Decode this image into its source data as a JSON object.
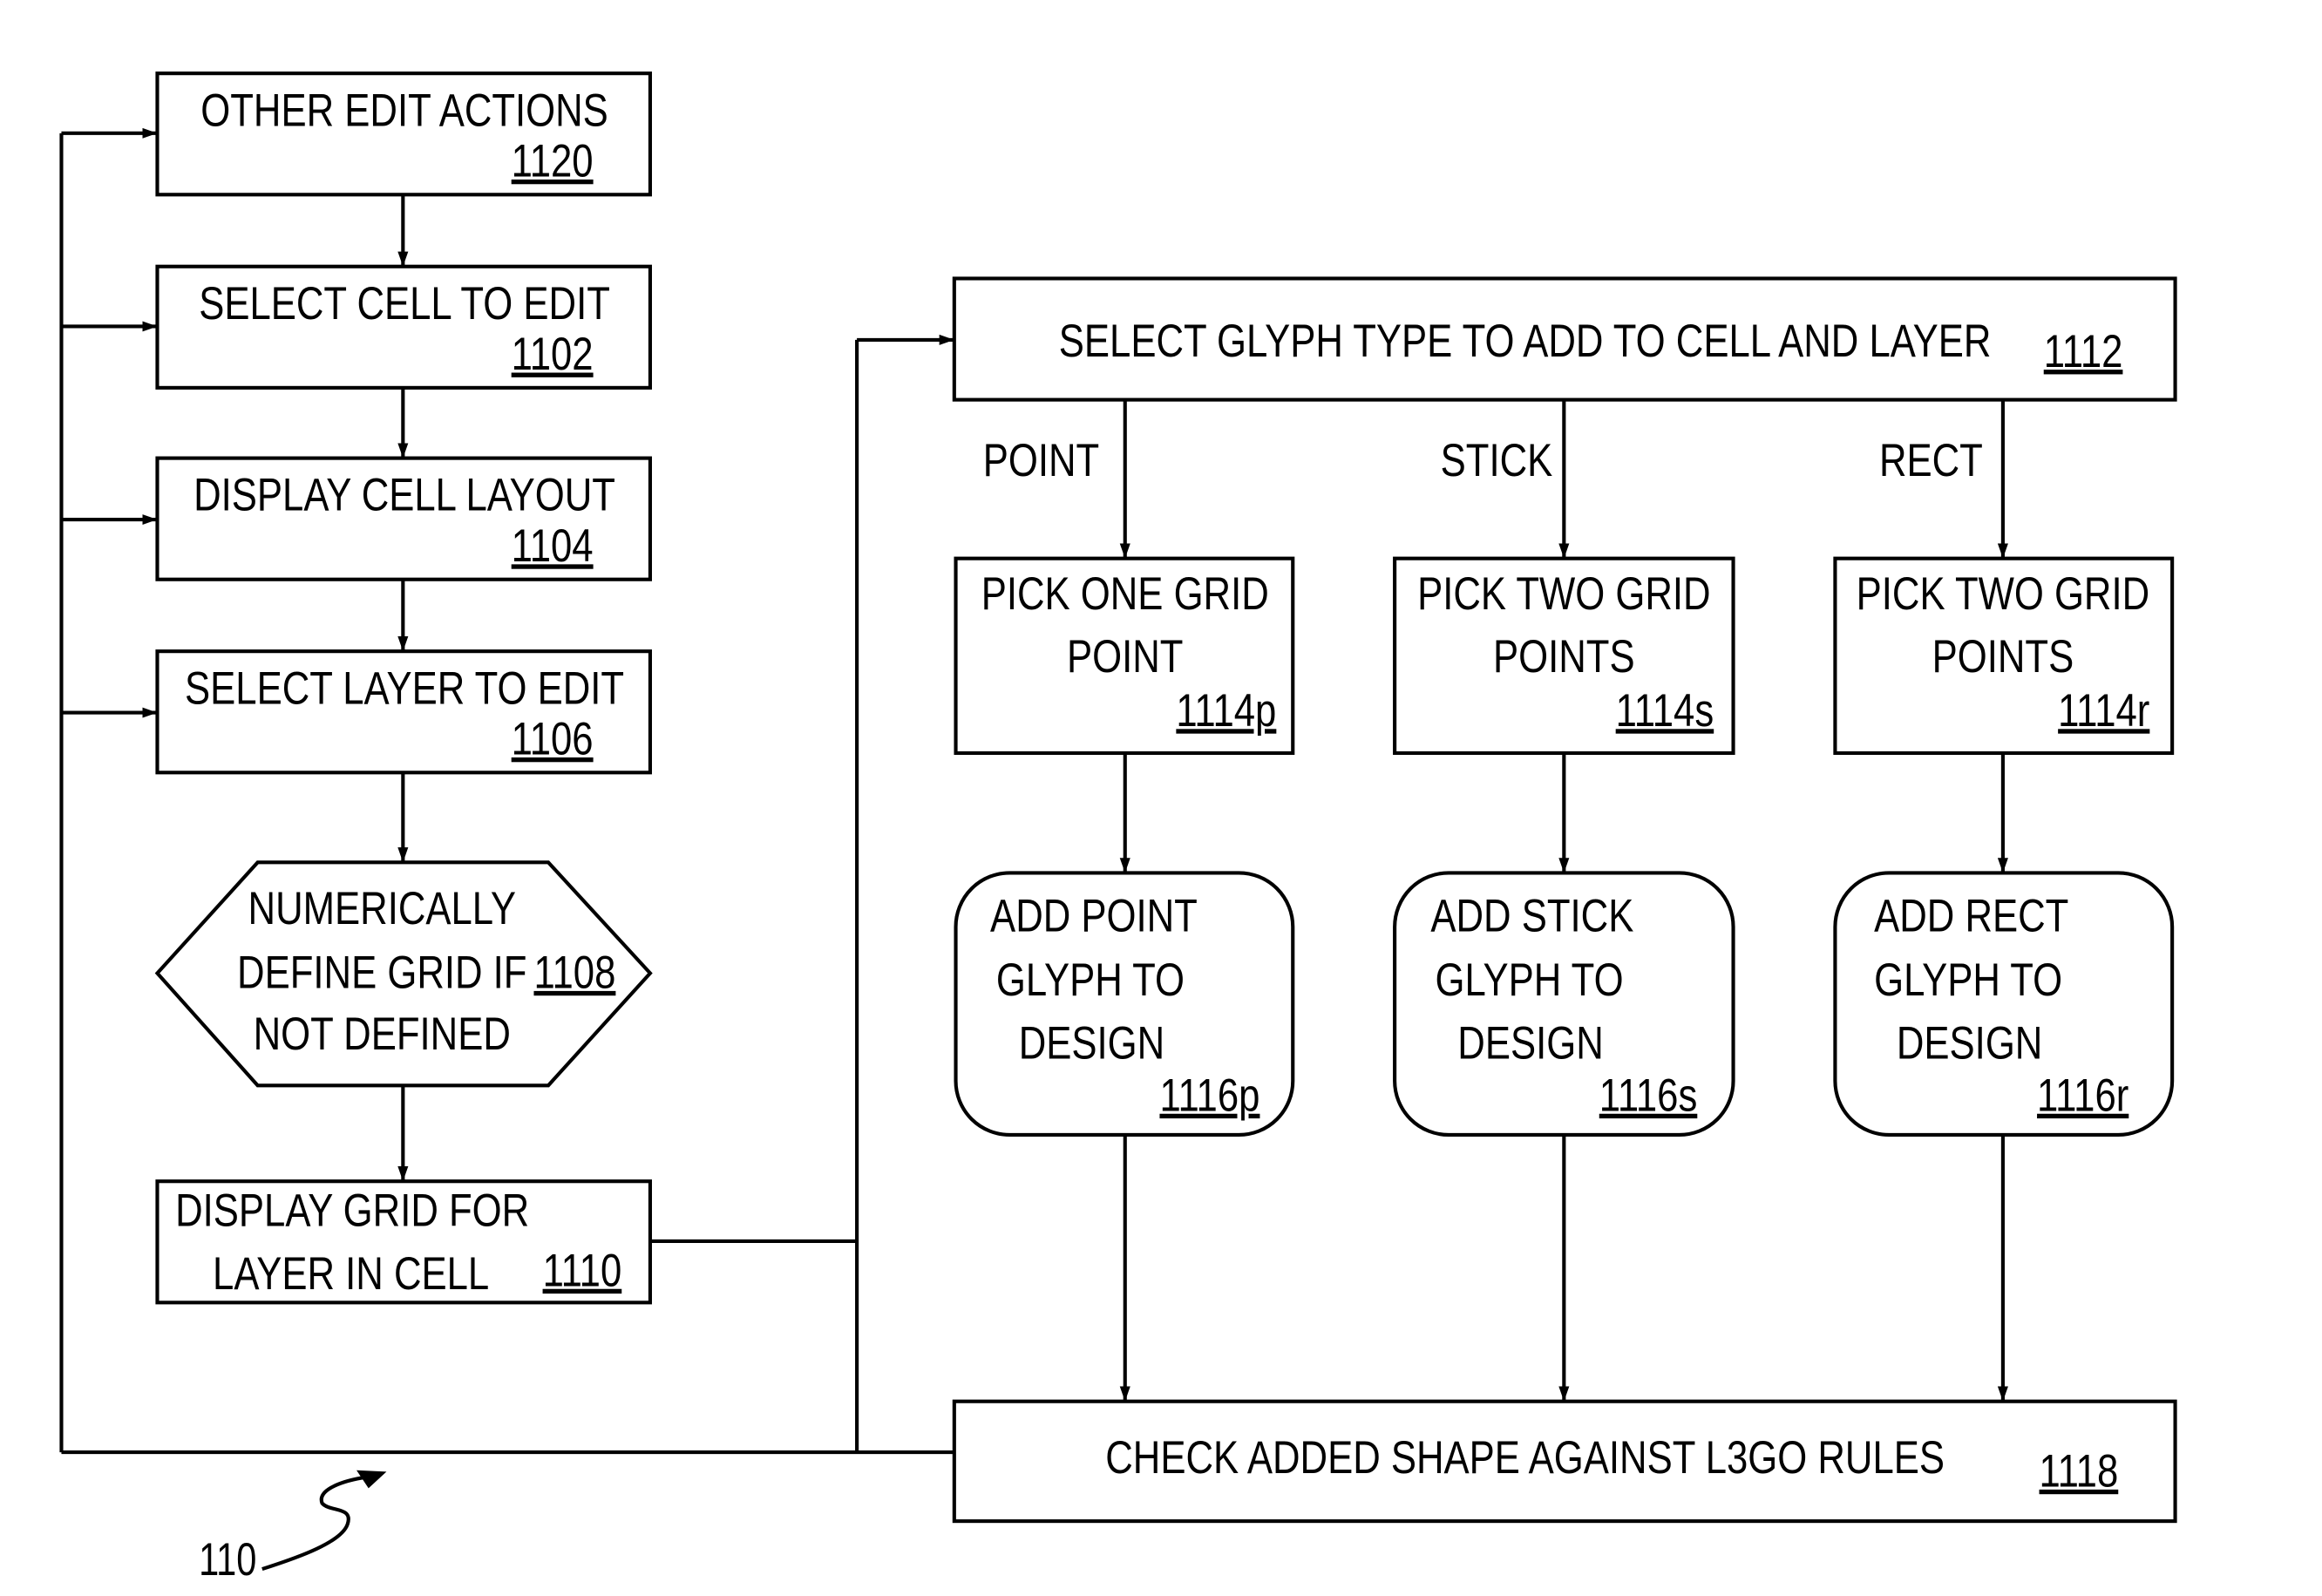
{
  "figure": {
    "reference_label": "110",
    "nodes": {
      "n1120": {
        "lines": [
          "OTHER EDIT ACTIONS"
        ],
        "ref": "1120"
      },
      "n1102": {
        "lines": [
          "SELECT CELL TO EDIT"
        ],
        "ref": "1102"
      },
      "n1104": {
        "lines": [
          "DISPLAY CELL LAYOUT"
        ],
        "ref": "1104"
      },
      "n1106": {
        "lines": [
          "SELECT LAYER TO EDIT"
        ],
        "ref": "1106"
      },
      "n1108": {
        "lines": [
          "NUMERICALLY",
          "DEFINE GRID IF",
          "NOT DEFINED"
        ],
        "ref": "1108"
      },
      "n1110": {
        "lines": [
          "DISPLAY GRID FOR",
          "LAYER IN CELL"
        ],
        "ref": "1110"
      },
      "n1112": {
        "lines": [
          "SELECT GLYPH TYPE TO ADD TO CELL AND LAYER"
        ],
        "ref": "1112"
      },
      "n1114p": {
        "lines": [
          "PICK ONE GRID",
          "POINT"
        ],
        "ref": "1114p"
      },
      "n1114s": {
        "lines": [
          "PICK TWO GRID",
          "POINTS"
        ],
        "ref": "1114s"
      },
      "n1114r": {
        "lines": [
          "PICK TWO GRID",
          "POINTS"
        ],
        "ref": "1114r"
      },
      "n1116p": {
        "lines": [
          "ADD POINT",
          "GLYPH TO",
          "DESIGN"
        ],
        "ref": "1116p"
      },
      "n1116s": {
        "lines": [
          "ADD STICK",
          "GLYPH TO",
          "DESIGN"
        ],
        "ref": "1116s"
      },
      "n1116r": {
        "lines": [
          "ADD RECT",
          "GLYPH TO",
          "DESIGN"
        ],
        "ref": "1116r"
      },
      "n1118": {
        "lines": [
          "CHECK ADDED SHAPE AGAINST L3GO RULES"
        ],
        "ref": "1118"
      }
    },
    "branch_labels": {
      "point": "POINT",
      "stick": "STICK",
      "rect": "RECT"
    }
  }
}
